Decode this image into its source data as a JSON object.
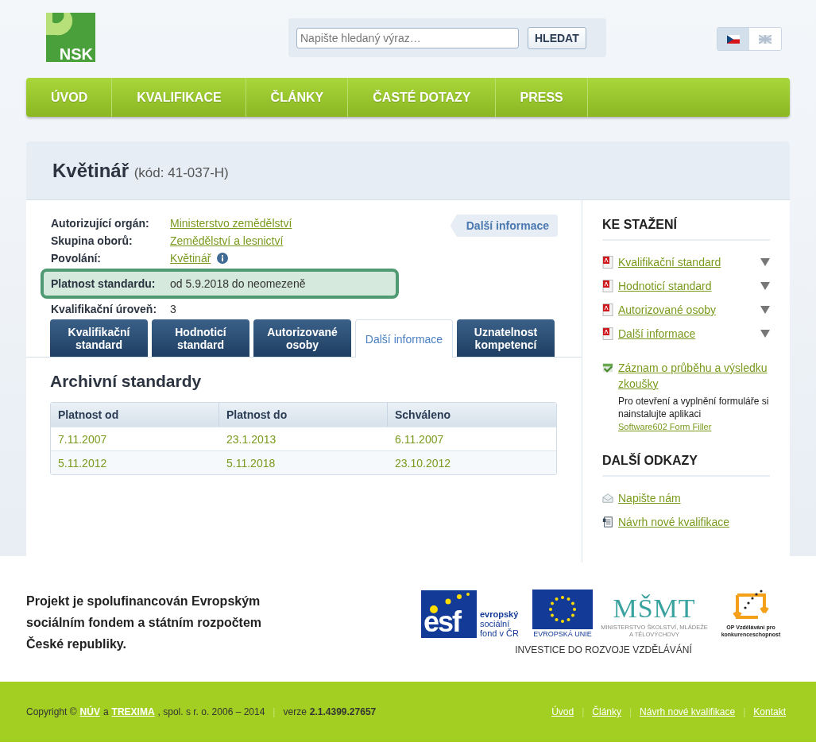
{
  "logo": {
    "text": "NSK"
  },
  "search": {
    "placeholder": "Napište hledaný výraz…",
    "button": "HLEDAT"
  },
  "languages": [
    {
      "kind": "cz",
      "selected": true
    },
    {
      "kind": "uk",
      "selected": false
    }
  ],
  "nav": [
    {
      "label": "ÚVOD"
    },
    {
      "label": "KVALIFIKACE"
    },
    {
      "label": "ČLÁNKY"
    },
    {
      "label": "ČASTÉ DOTAZY"
    },
    {
      "label": "PRESS"
    }
  ],
  "page": {
    "title": "Květinář",
    "code": "(kód: 41-037-H)"
  },
  "details": [
    {
      "kind": "link",
      "label": "Autorizující orgán:",
      "value": "Ministerstvo zemědělství",
      "info": false
    },
    {
      "kind": "link",
      "label": "Skupina oborů:",
      "value": "Zemědělství a lesnictví",
      "info": false
    },
    {
      "kind": "link",
      "label": "Povolání:",
      "value": "Květinář",
      "info": true
    },
    {
      "kind": "highlight",
      "label": "Platnost standardu:",
      "value": "od 5.9.2018 do neomezeně",
      "info": false
    },
    {
      "kind": "text",
      "label": "Kvalifikační úroveň:",
      "value": "3",
      "info": false
    }
  ],
  "more_info": "Další informace",
  "tabs": [
    {
      "label": "Kvalifikační standard",
      "selected": false
    },
    {
      "label": "Hodnoticí standard",
      "selected": false
    },
    {
      "label": "Autorizované osoby",
      "selected": false
    },
    {
      "label": "Další informace",
      "selected": true
    },
    {
      "label": "Uznatelnost kompetencí",
      "selected": false
    }
  ],
  "archive": {
    "title": "Archivní standardy",
    "columns": [
      "Platnost od",
      "Platnost do",
      "Schváleno"
    ],
    "rows": [
      [
        "7.11.2007",
        "23.1.2013",
        "6.11.2007"
      ],
      [
        "5.11.2012",
        "5.11.2018",
        "23.10.2012"
      ]
    ]
  },
  "sidebar": {
    "downloads_title": "KE STAŽENÍ",
    "downloads": [
      {
        "label": "Kvalifikační standard"
      },
      {
        "label": "Hodnoticí standard"
      },
      {
        "label": "Autorizované osoby"
      },
      {
        "label": "Další informace"
      }
    ],
    "form_link": "Záznam o průběhu a výsledku zkoušky",
    "form_note": "Pro otevření a vyplnění formuláře si nainstalujte aplikaci",
    "form_note_link": "Software602 Form Filler",
    "links_title": "DALŠÍ ODKAZY",
    "links": [
      {
        "kind": "mail",
        "label": "Napište nám"
      },
      {
        "kind": "doc",
        "label": "Návrh nové kvalifikace"
      }
    ]
  },
  "funding": {
    "text": "Projekt je spolufinancován Evropským sociálním fondem a státním rozpočtem České republiky.",
    "esf_letters": "esf",
    "esf_text": "evropský sociální fond v ČR",
    "eu_text": "EVROPSKÁ UNIE",
    "msmt_letters": "MŠMT",
    "msmt_text": "MINISTERSTVO ŠKOLSTVÍ, MLÁDEŽE A TĚLOVÝCHOVY",
    "op_text": "OP Vzdělávání pro konkurenceschopnost",
    "slogan": "INVESTICE DO ROZVOJE VZDĚLÁVÁNÍ"
  },
  "footer": {
    "left": [
      {
        "kind": "text",
        "text": "Copyright ©"
      },
      {
        "kind": "link",
        "text": "NÚV"
      },
      {
        "kind": "text",
        "text": "a"
      },
      {
        "kind": "link",
        "text": "TREXIMA"
      },
      {
        "kind": "text",
        "text": ", spol. s r. o. 2006 – 2014"
      },
      {
        "kind": "sep",
        "text": "|"
      },
      {
        "kind": "text",
        "text": "verze"
      },
      {
        "kind": "bold",
        "text": "2.1.4399.27657"
      }
    ],
    "right": [
      {
        "kind": "link",
        "text": "Úvod"
      },
      {
        "kind": "sep",
        "text": "|"
      },
      {
        "kind": "link",
        "text": "Články"
      },
      {
        "kind": "sep",
        "text": "|"
      },
      {
        "kind": "link",
        "text": "Návrh nové kvalifikace"
      },
      {
        "kind": "sep",
        "text": "|"
      },
      {
        "kind": "link",
        "text": "Kontakt"
      }
    ]
  }
}
